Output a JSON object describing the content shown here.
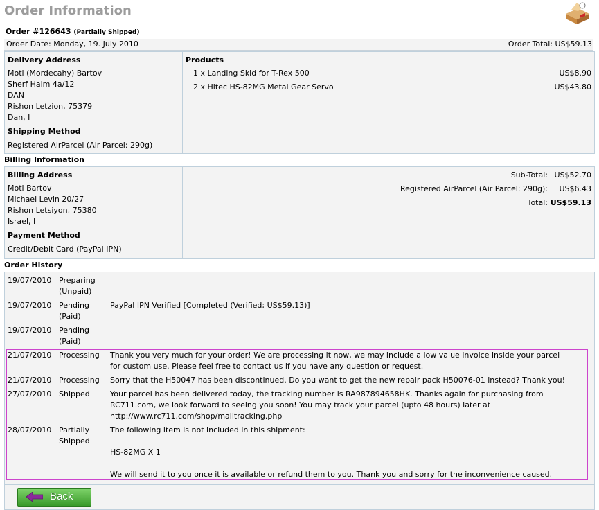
{
  "page": {
    "title": "Order Information"
  },
  "order": {
    "number": "Order #126643",
    "status": "(Partially Shipped)",
    "date": "Order Date: Monday, 19. July 2010",
    "total": "Order Total: US$59.13"
  },
  "delivery": {
    "heading": "Delivery Address",
    "lines": [
      "Moti (Mordecahy) Bartov",
      "Sherf Haim 4a/12",
      "DAN",
      "Rishon Letzion, 75379",
      "Dan, I"
    ],
    "shipping_heading": "Shipping Method",
    "shipping_method": "Registered AirParcel (Air Parcel: 290g)"
  },
  "products": {
    "heading": "Products",
    "items": [
      {
        "desc": "1 x Landing Skid for T-Rex 500",
        "price": "US$8.90"
      },
      {
        "desc": "2 x Hitec HS-82MG Metal Gear Servo",
        "price": "US$43.80"
      }
    ]
  },
  "billing_info_title": "Billing Information",
  "billing": {
    "heading": "Billing Address",
    "lines": [
      "Moti Bartov",
      "Michael Levin 20/27",
      "Rishon Letsiyon, 75380",
      "Israel, I"
    ],
    "payment_heading": "Payment Method",
    "payment_method": "Credit/Debit Card (PayPal IPN)"
  },
  "totals": [
    {
      "label": "Sub-Total:",
      "value": "US$52.70"
    },
    {
      "label": "Registered AirParcel (Air Parcel: 290g):",
      "value": "US$6.43"
    },
    {
      "label": "Total:",
      "value": "US$59.13"
    }
  ],
  "history": {
    "title": "Order History",
    "rows": [
      {
        "date": "19/07/2010",
        "status": [
          "Preparing",
          "(Unpaid)"
        ],
        "comment": []
      },
      {
        "date": "19/07/2010",
        "status": [
          "Pending",
          "(Paid)"
        ],
        "comment": [
          "PayPal IPN Verified [Completed (Verified; US$59.13)]"
        ]
      },
      {
        "date": "19/07/2010",
        "status": [
          "Pending",
          "(Paid)"
        ],
        "comment": []
      },
      {
        "date": "21/07/2010",
        "status": [
          "Processing"
        ],
        "comment": [
          "Thank you very much for your order! We are processing it now, we may include a low value invoice inside your parcel",
          "for custom use. Please feel free to contact us if you have any question or request."
        ]
      },
      {
        "date": "21/07/2010",
        "status": [
          "Processing"
        ],
        "comment": [
          "Sorry that the H50047 has been discontinued. Do you want to get the new repair pack H50076-01 instead? Thank you!"
        ]
      },
      {
        "date": "27/07/2010",
        "status": [
          "Shipped"
        ],
        "comment": [
          "Your parcel has been delivered today, the tracking number is RA987894658HK. Thanks again for purchasing from",
          "RC711.com, we look forward to seeing you soon! You may track your parcel (upto 48 hours) later at",
          "http://www.rc711.com/shop/mailtracking.php"
        ]
      },
      {
        "date": "28/07/2010",
        "status": [
          "Partially",
          "Shipped"
        ],
        "comment": [
          "The following item is not included in this shipment:",
          "",
          "HS-82MG X 1",
          "",
          "We will send it to you once it is available or refund them to you. Thank you and sorry for the inconvenience caused."
        ]
      }
    ]
  },
  "footer": {
    "back_label": "Back"
  },
  "icons": {
    "logo": "box-icon",
    "back_arrow": "arrow-left-icon"
  },
  "colors": {
    "title_gray": "#9c9c9c",
    "highlight_border": "#cc44cc",
    "button_green": "#4caf3a",
    "arrow_purple": "#8a2a9a"
  }
}
